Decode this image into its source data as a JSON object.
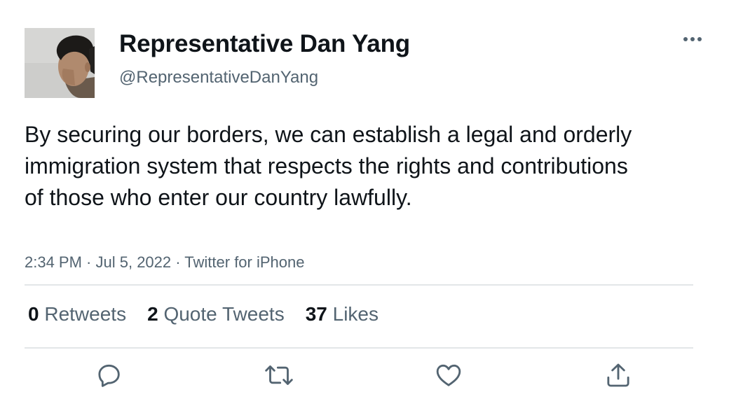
{
  "author": {
    "display_name": "Representative Dan Yang",
    "handle": "@RepresentativeDanYang"
  },
  "tweet": {
    "text": "By securing our borders, we can establish a legal and orderly immigration system that respects the rights and contributions of those who enter our country lawfully.",
    "time": "2:34 PM",
    "date": "Jul 5, 2022",
    "source": "Twitter for iPhone",
    "separator": " · "
  },
  "stats": {
    "retweets_count": "0",
    "retweets_label": "Retweets",
    "quotes_count": "2",
    "quotes_label": "Quote Tweets",
    "likes_count": "37",
    "likes_label": "Likes"
  },
  "icons": {
    "more": "more-horizontal-icon",
    "reply": "reply-icon",
    "retweet": "retweet-icon",
    "like": "heart-icon",
    "share": "share-icon"
  },
  "colors": {
    "text": "#0f1419",
    "secondary": "#536471",
    "divider": "#e3e6e8"
  }
}
